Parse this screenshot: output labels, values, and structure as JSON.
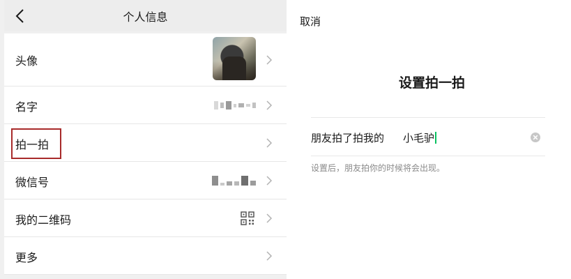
{
  "left_panel": {
    "header": {
      "title": "个人信息",
      "back_icon": "chevron-left-icon"
    },
    "rows": [
      {
        "label": "头像"
      },
      {
        "label": "名字"
      },
      {
        "label": "拍一拍"
      },
      {
        "label": "微信号"
      },
      {
        "label": "我的二维码"
      },
      {
        "label": "更多"
      }
    ],
    "highlight_color": "#a82a2a"
  },
  "right_panel": {
    "cancel_label": "取消",
    "title": "设置拍一拍",
    "input": {
      "prefix": "朋友拍了拍我的",
      "value": "小毛驴"
    },
    "hint": "设置后，朋友拍你的时候将会出现。",
    "caret_color": "#07c160"
  }
}
